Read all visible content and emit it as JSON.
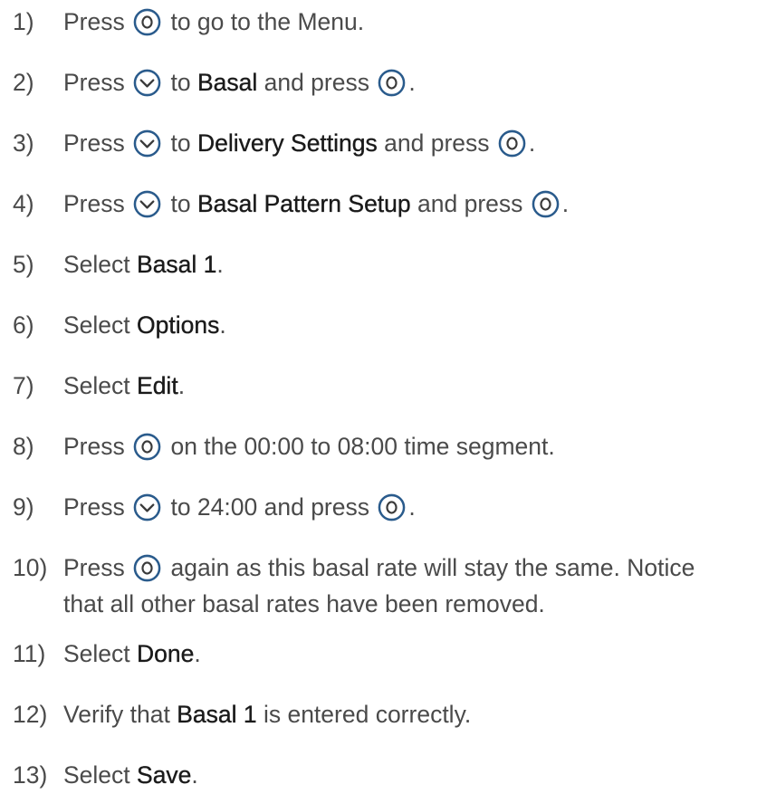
{
  "steps": [
    {
      "num": "1)",
      "parts": [
        {
          "t": "text",
          "v": "Press "
        },
        {
          "t": "icon",
          "v": "select-button-icon"
        },
        {
          "t": "text",
          "v": " to go to the Menu."
        }
      ]
    },
    {
      "num": "2)",
      "parts": [
        {
          "t": "text",
          "v": "Press "
        },
        {
          "t": "icon",
          "v": "down-button-icon"
        },
        {
          "t": "text",
          "v": " to "
        },
        {
          "t": "bold",
          "v": "Basal"
        },
        {
          "t": "text",
          "v": " and press "
        },
        {
          "t": "icon",
          "v": "select-button-icon"
        },
        {
          "t": "text",
          "v": "."
        }
      ]
    },
    {
      "num": "3)",
      "parts": [
        {
          "t": "text",
          "v": "Press "
        },
        {
          "t": "icon",
          "v": "down-button-icon"
        },
        {
          "t": "text",
          "v": " to "
        },
        {
          "t": "bold",
          "v": "Delivery Settings"
        },
        {
          "t": "text",
          "v": " and press "
        },
        {
          "t": "icon",
          "v": "select-button-icon"
        },
        {
          "t": "text",
          "v": "."
        }
      ]
    },
    {
      "num": "4)",
      "parts": [
        {
          "t": "text",
          "v": "Press "
        },
        {
          "t": "icon",
          "v": "down-button-icon"
        },
        {
          "t": "text",
          "v": " to "
        },
        {
          "t": "bold",
          "v": "Basal Pattern Setup"
        },
        {
          "t": "text",
          "v": " and press "
        },
        {
          "t": "icon",
          "v": "select-button-icon"
        },
        {
          "t": "text",
          "v": "."
        }
      ]
    },
    {
      "num": "5)",
      "parts": [
        {
          "t": "text",
          "v": "Select "
        },
        {
          "t": "bold",
          "v": "Basal 1"
        },
        {
          "t": "text",
          "v": "."
        }
      ]
    },
    {
      "num": "6)",
      "parts": [
        {
          "t": "text",
          "v": "Select "
        },
        {
          "t": "bold",
          "v": "Options"
        },
        {
          "t": "text",
          "v": "."
        }
      ]
    },
    {
      "num": "7)",
      "parts": [
        {
          "t": "text",
          "v": "Select "
        },
        {
          "t": "bold",
          "v": "Edit"
        },
        {
          "t": "text",
          "v": "."
        }
      ]
    },
    {
      "num": "8)",
      "parts": [
        {
          "t": "text",
          "v": "Press "
        },
        {
          "t": "icon",
          "v": "select-button-icon"
        },
        {
          "t": "text",
          "v": " on the 00:00 to 08:00 time segment."
        }
      ]
    },
    {
      "num": "9)",
      "parts": [
        {
          "t": "text",
          "v": "Press "
        },
        {
          "t": "icon",
          "v": "down-button-icon"
        },
        {
          "t": "text",
          "v": " to 24:00 and press "
        },
        {
          "t": "icon",
          "v": "select-button-icon"
        },
        {
          "t": "text",
          "v": "."
        }
      ]
    },
    {
      "num": "10)",
      "parts": [
        {
          "t": "text",
          "v": "Press "
        },
        {
          "t": "icon",
          "v": "select-button-icon"
        },
        {
          "t": "text",
          "v": " again as this basal rate will stay the same. Notice"
        },
        {
          "t": "br"
        },
        {
          "t": "text",
          "v": "that all other basal rates have been removed."
        }
      ]
    },
    {
      "num": "11)",
      "parts": [
        {
          "t": "text",
          "v": "Select "
        },
        {
          "t": "bold",
          "v": "Done"
        },
        {
          "t": "text",
          "v": "."
        }
      ]
    },
    {
      "num": "12)",
      "parts": [
        {
          "t": "text",
          "v": "Verify that "
        },
        {
          "t": "bold",
          "v": "Basal 1"
        },
        {
          "t": "text",
          "v": " is entered correctly."
        }
      ]
    },
    {
      "num": "13)",
      "parts": [
        {
          "t": "text",
          "v": "Select "
        },
        {
          "t": "bold",
          "v": "Save"
        },
        {
          "t": "text",
          "v": "."
        }
      ]
    }
  ],
  "colors": {
    "text": "#4a4a4a",
    "emphasis": "#1a1a1a",
    "icon_ring": "#2a5b8c",
    "icon_glyph": "#3a3a3a"
  }
}
